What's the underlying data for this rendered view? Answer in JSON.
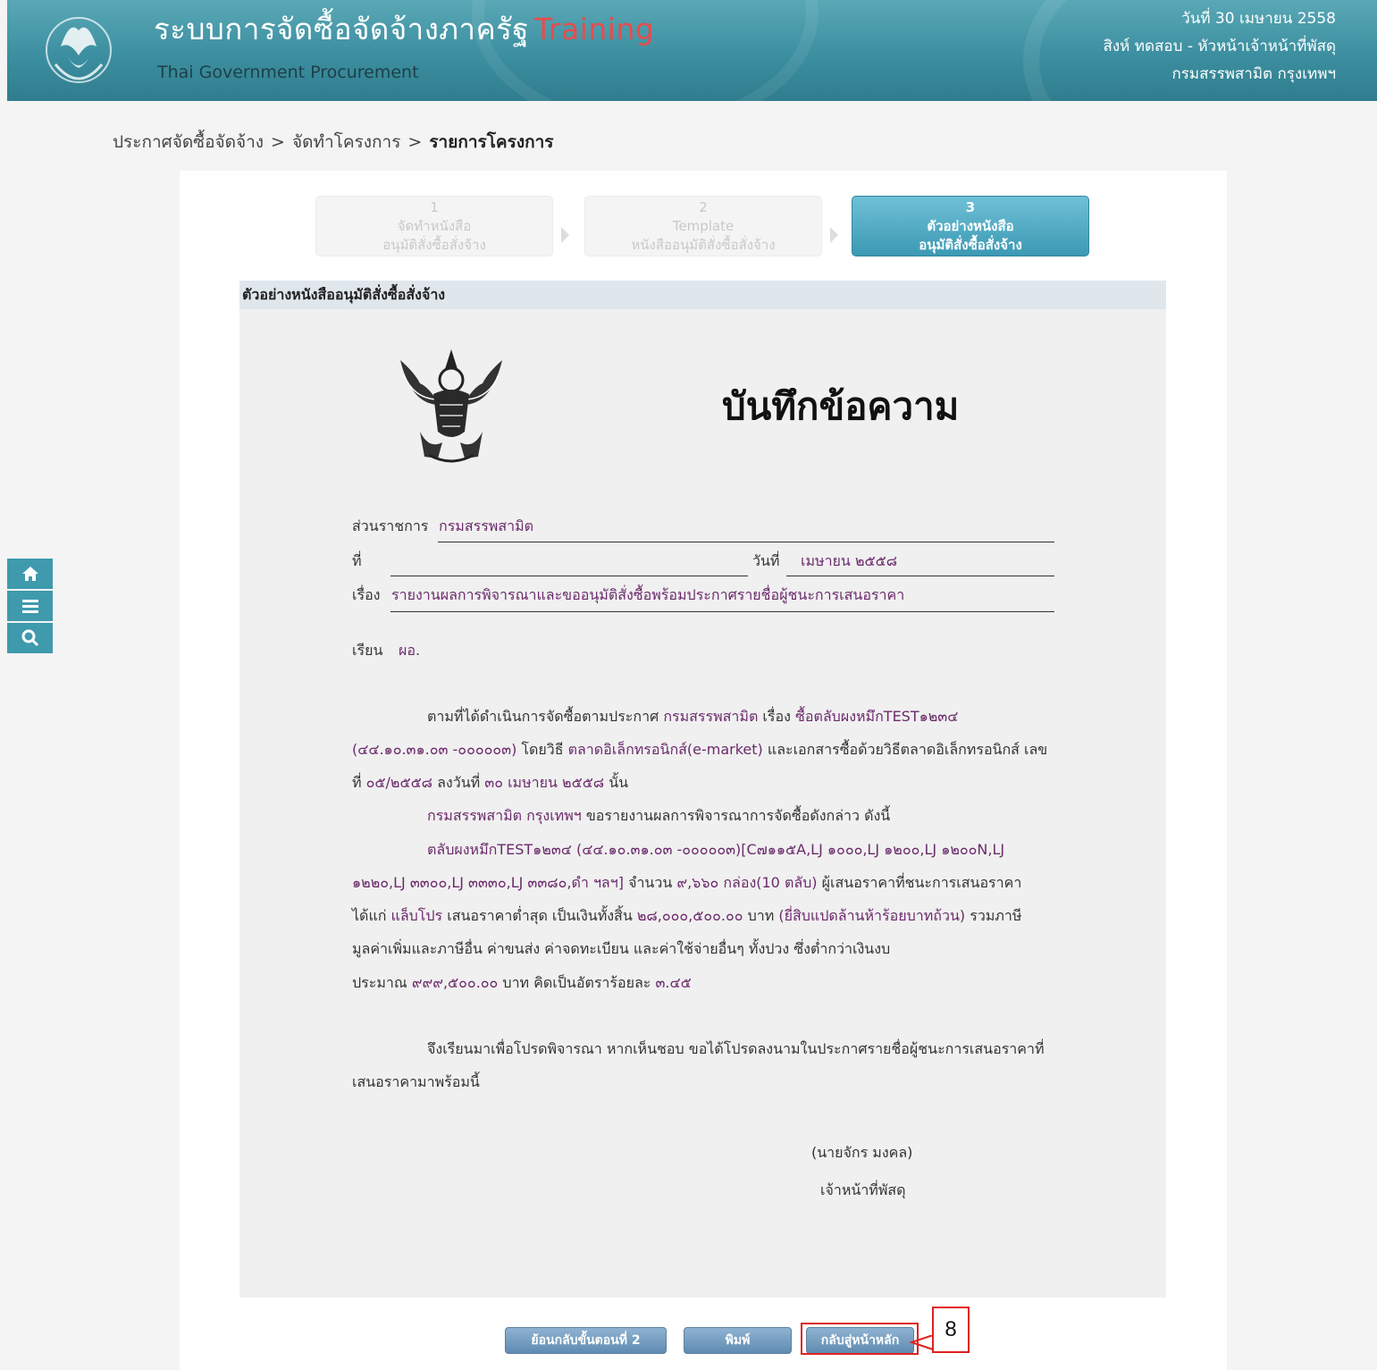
{
  "header": {
    "title": "ระบบการจัดซื้อจัดจ้างภาครัฐ",
    "title_suffix": "Training",
    "subtitle": "Thai Government Procurement",
    "date": "วันที่ 30 เมษายน 2558",
    "user": "สิงห์ ทดสอบ - หัวหน้าเจ้าหน้าที่พัสดุ",
    "org": "กรมสรรพสามิต กรุงเทพฯ"
  },
  "breadcrumb": {
    "item1": "ประกาศจัดซื้อจัดจ้าง",
    "item2": "จัดทำโครงการ",
    "item3": "รายการโครงการ",
    "sep": ">"
  },
  "steps": [
    {
      "num": "1",
      "line1": "จัดทำหนังสือ",
      "line2": "อนุมัติสั่งซื้อสั่งจ้าง"
    },
    {
      "num": "2",
      "line1": "Template",
      "line2": "หนังสืออนุมัติสั่งซื้อสั่งจ้าง"
    },
    {
      "num": "3",
      "line1": "ตัวอย่างหนังสือ",
      "line2": "อนุมัติสั่งซื้อสั่งจ้าง"
    }
  ],
  "section_title": "ตัวอย่างหนังสืออนุมัติสั่งซื้อสั่งจ้าง",
  "memo": {
    "title": "บันทึกข้อความ",
    "dept_label": "ส่วนราชการ",
    "dept_value": "กรมสรรพสามิต",
    "ref_label": "ที่",
    "date_label": "วันที่",
    "date_value": "เมษายน ๒๕๕๘",
    "subject_label": "เรื่อง",
    "subject_value": "รายงานผลการพิจารณาและขออนุมัติสั่งซื้อพร้อมประกาศรายชื่อผู้ชนะการเสนอราคา",
    "to_label": "เรียน",
    "to_value": "ผอ.",
    "p1_a": "ตามที่ได้ดำเนินการจัดซื้อตามประกาศ",
    "p1_b": "กรมสรรพสามิต",
    "p1_c": "เรื่อง",
    "p1_d": "ซื้อตลับผงหมึกTEST๑๒๓๔",
    "p1_e": "(๔๔.๑๐.๓๑.๐๓ -๐๐๐๐๐๓)",
    "p1_f": "โดยวิธี",
    "p1_g": "ตลาดอิเล็กทรอนิกส์(e-market)",
    "p1_h": "และเอกสารซื้อด้วยวิธีตลาดอิเล็กทรอนิกส์ เลข",
    "p1_i": "ที่",
    "p1_j": "๐๕/๒๕๕๘",
    "p1_k": "ลงวันที่",
    "p1_l": "๓๐ เมษายน ๒๕๕๘",
    "p1_m": "นั้น",
    "p2_a": "กรมสรรพสามิต กรุงเทพฯ",
    "p2_b": "ขอรายงานผลการพิจารณาการจัดซื้อดังกล่าว ดังนี้",
    "p3_l1": "ตลับผงหมึกTEST๑๒๓๔ (๔๔.๑๐.๓๑.๐๓ -๐๐๐๐๐๓)[C๗๑๑๕A,LJ ๑๐๐๐,LJ ๑๒๐๐,LJ ๑๒๐๐N,LJ",
    "p3_l2a": "๑๒๒๐,LJ ๓๓๐๐,LJ ๓๓๓๐,LJ ๓๓๘๐,ดำ ฯลฯ]",
    "p3_l2b": "จำนวน",
    "p3_l2c": "๙,๖๖๐ กล่อง(10 ตลับ)",
    "p3_l2d": "ผู้เสนอราคาที่ชนะการเสนอราคา",
    "p3_l3a": "ได้แก่",
    "p3_l3b": "แล็บโปร",
    "p3_l3c": "เสนอราคาต่ำสุด เป็นเงินทั้งสิ้น",
    "p3_l3d": "๒๘,๐๐๐,๕๐๐.๐๐",
    "p3_l3e": "บาท",
    "p3_l3f": "(ยี่สิบแปดล้านห้าร้อยบาทถ้วน)",
    "p3_l3g": "รวมภาษี",
    "p3_l4": "มูลค่าเพิ่มและภาษีอื่น ค่าขนส่ง ค่าจดทะเบียน และค่าใช้จ่ายอื่นๆ ทั้งปวง ซึ่งต่ำกว่าเงินงบ",
    "p3_l5a": "ประมาณ",
    "p3_l5b": "๙๙๙,๕๐๐.๐๐",
    "p3_l5c": "บาท คิดเป็นอัตราร้อยละ",
    "p3_l5d": "๓.๔๕",
    "p4_l1": "จึงเรียนมาเพื่อโปรดพิจารณา หากเห็นชอบ ขอได้โปรดลงนามในประกาศรายชื่อผู้ชนะการเสนอราคาที่",
    "p4_l2": "เสนอราคามาพร้อมนี้",
    "signer": "(นายจักร มงคล)",
    "position": "เจ้าหน้าที่พัสดุ"
  },
  "buttons": {
    "back": "ย้อนกลับขั้นตอนที่ 2",
    "print": "พิมพ์",
    "home": "กลับสู่หน้าหลัก"
  },
  "callout": "8",
  "sidenav": [
    "home-icon",
    "menu-icon",
    "search-icon"
  ],
  "colors": {
    "accent": "#3f9aad",
    "callout": "#e02020",
    "value_text": "#6b2a6b",
    "training": "#e84c4c"
  }
}
